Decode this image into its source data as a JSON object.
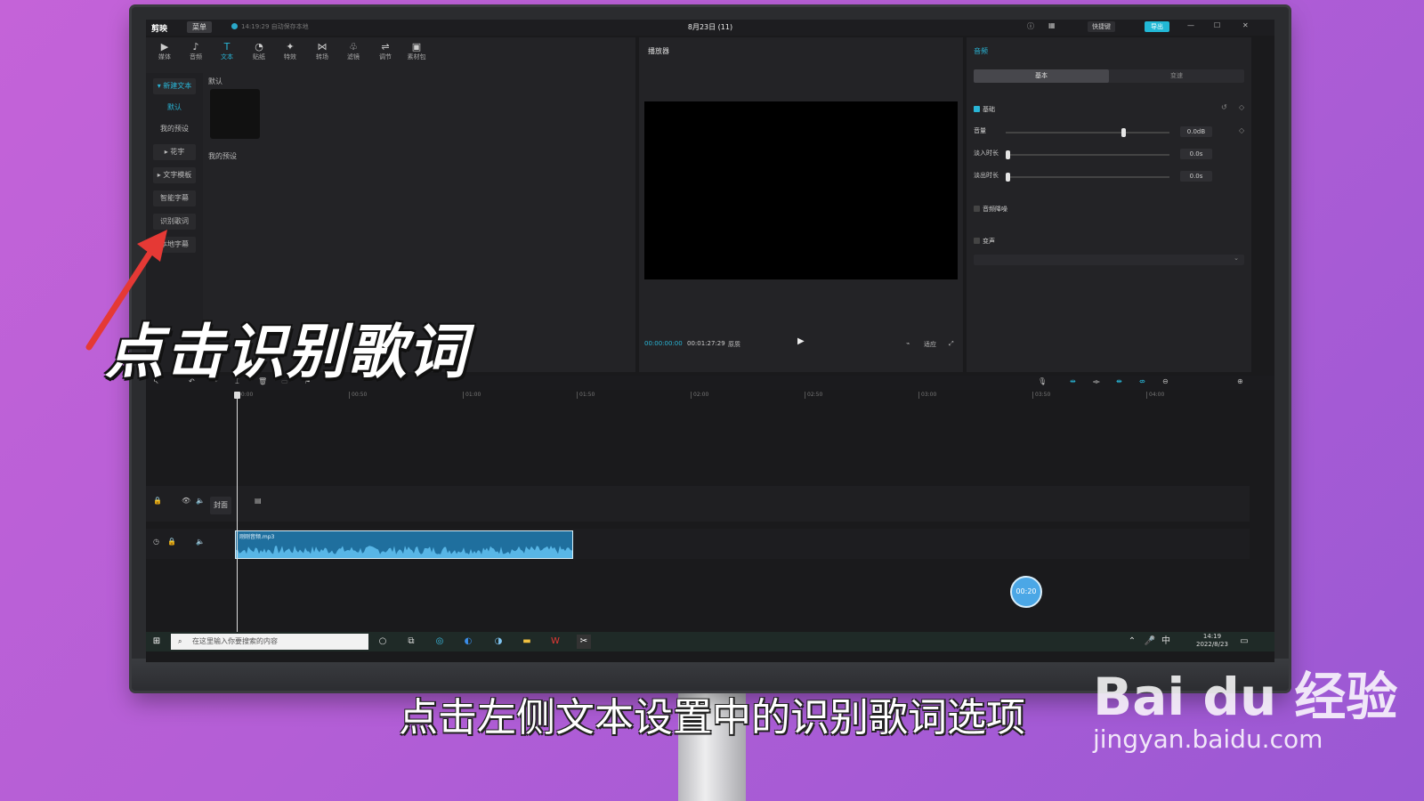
{
  "app": {
    "logo": "剪映",
    "menu": "菜单",
    "autosave": "14:19:29 自动保存本地",
    "project_title": "8月23日 (11)",
    "shortcut": "快捷键",
    "export": "导出"
  },
  "media_toolbar": [
    {
      "label": "媒体",
      "icon": "▶"
    },
    {
      "label": "音频",
      "icon": "♪"
    },
    {
      "label": "文本",
      "icon": "T"
    },
    {
      "label": "贴纸",
      "icon": "◔"
    },
    {
      "label": "特效",
      "icon": "✦"
    },
    {
      "label": "转场",
      "icon": "⋈"
    },
    {
      "label": "滤镜",
      "icon": "♧"
    },
    {
      "label": "调节",
      "icon": "⇌"
    },
    {
      "label": "素材包",
      "icon": "▣"
    }
  ],
  "text_sidebar": {
    "new_text": "新建文本",
    "default": "默认",
    "my_presets": "我的预设",
    "flower_text": "花字",
    "text_template": "文字模板",
    "smart_subtitle": "智能字幕",
    "recognize_lyrics": "识别歌词",
    "local_subtitle": "本地字幕"
  },
  "text_content": {
    "default_label": "默认",
    "my_presets_label": "我的预设"
  },
  "player": {
    "title": "播放器",
    "current_time": "00:00:00:00",
    "total_time": "00:01:27:29",
    "quality": "原质",
    "ratio": "适应"
  },
  "audio_panel": {
    "title": "音频",
    "tab_basic": "基本",
    "tab_speed": "变速",
    "basic_label": "基础",
    "volume_label": "音量",
    "volume_value": "0.0dB",
    "volume_level": 0.72,
    "fade_in_label": "淡入时长",
    "fade_in_value": "0.0s",
    "fade_out_label": "淡出时长",
    "fade_out_value": "0.0s",
    "denoise_label": "音频降噪",
    "voice_change_label": "变声"
  },
  "timeline": {
    "ticks": [
      "00:00",
      "00:50",
      "01:00",
      "01:50",
      "02:00",
      "02:50",
      "03:00",
      "03:50",
      "04:00"
    ],
    "cover_label": "封面",
    "clip_name": "刚刚音频.mp3",
    "bubble_time": "00:20"
  },
  "taskbar": {
    "search_placeholder": "在这里输入你要搜索的内容",
    "time": "14:19",
    "date": "2022/8/23",
    "ime": "中"
  },
  "overlay": {
    "callout": "点击识别歌词",
    "subtitle": "点击左侧文本设置中的识别歌词选项",
    "watermark": "Bai du 经验",
    "watermark_url": "jingyan.baidu.com"
  },
  "colors": {
    "accent": "#29b5d6",
    "annotation_arrow": "#e53935"
  }
}
